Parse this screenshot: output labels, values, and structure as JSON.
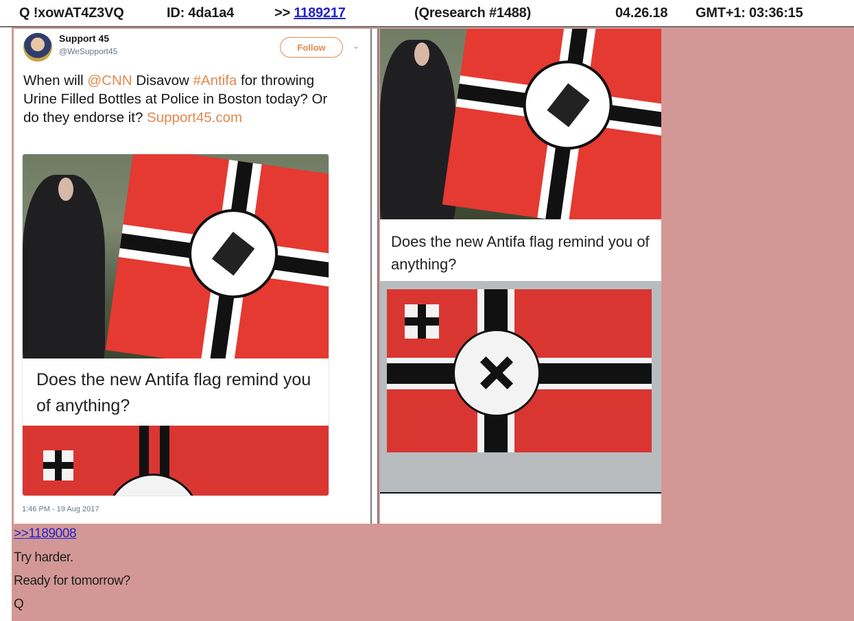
{
  "header": {
    "tripcode": "Q !xowAT4Z3VQ",
    "id": "ID: 4da1a4",
    "ref_prefix": ">>",
    "ref_link": "1189217",
    "thread": "(Qresearch #1488)",
    "date": "04.26.18",
    "time": "GMT+1: 03:36:15"
  },
  "tweet": {
    "name": "Support 45",
    "handle": "@WeSupport45",
    "follow_label": "Follow",
    "text_parts": {
      "p1": "When will ",
      "mention": "@CNN",
      "p2": " Disavow ",
      "hashtag": "#Antifa",
      "p3": " for throwing Urine Filled Bottles at Police in Boston today? Or do they endorse it? ",
      "link": "Support45.com"
    },
    "timestamp": "1:46 PM - 19 Aug 2017",
    "image_caption": "Does the new Antifa flag remind you of anything?"
  },
  "right_image": {
    "caption": "Does the new Antifa flag remind you of anything?"
  },
  "post": {
    "reply_link": ">>1189008",
    "lines": [
      "Try harder.",
      "Ready for tomorrow?",
      "Q"
    ]
  },
  "colors": {
    "post_bg": "#d39895",
    "flag_red": "#d93632",
    "link_blue": "#2222cc",
    "twitter_orange": "#e0894d"
  }
}
